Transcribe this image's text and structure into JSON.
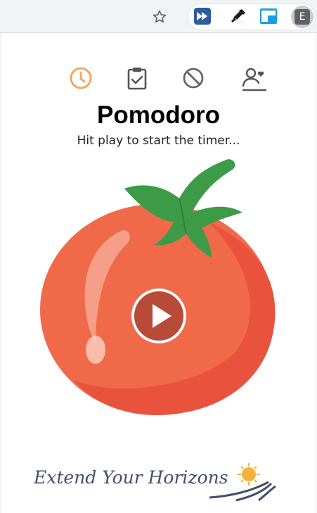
{
  "browser": {
    "profile_initial": "E",
    "extensions": [
      "fast-forward-icon",
      "eyedropper-icon",
      "picture-in-picture-icon"
    ]
  },
  "app": {
    "tabs": [
      {
        "name": "timer",
        "icon": "clock-icon",
        "active": true
      },
      {
        "name": "tasks",
        "icon": "clipboard-check-icon",
        "active": false
      },
      {
        "name": "blocklist",
        "icon": "block-icon",
        "active": false
      },
      {
        "name": "profile",
        "icon": "user-heart-icon",
        "active": false
      }
    ],
    "title": "Pomodoro",
    "subtitle": "Hit play to start the timer...",
    "footer": "Extend Your Horizons"
  },
  "colors": {
    "accent": "#f5a05c",
    "tomato": "#f06a4a",
    "tomato_dark": "#e9533d",
    "leaves": "#3d9b48",
    "play_button": "#b84a38",
    "nav_icon": "#555555"
  }
}
